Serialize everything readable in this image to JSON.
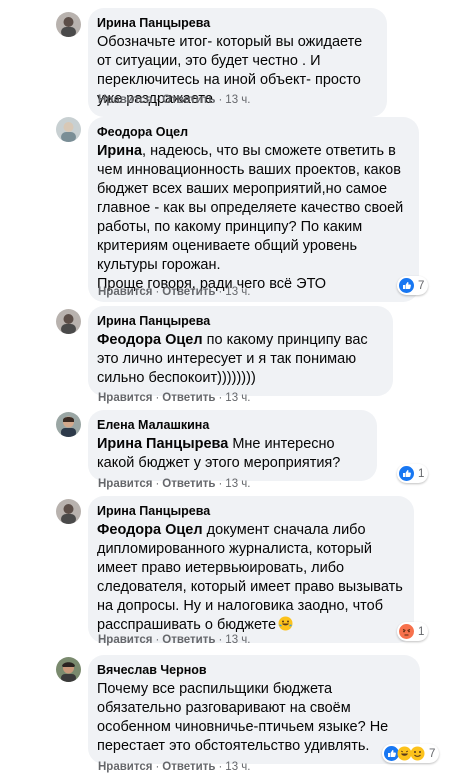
{
  "labels": {
    "like": "Нравится",
    "reply": "Ответить",
    "dot": "·"
  },
  "colors": {
    "bubble": "#f0f2f5",
    "meta": "#65676b",
    "like_blue": "#1877f2",
    "angry_orange": "#f7714c"
  },
  "comments": [
    {
      "author": "Ирина Панцырева",
      "mention": "",
      "text": "Обозначьте итог- который вы ожидаете от ситуации, это будет честно . И переключитесь на иной объект- просто уже раздражаете",
      "time": "13 ч.",
      "reactions": null
    },
    {
      "author": "Феодора Оцел",
      "mention": "Ирина",
      "text": ", надеюсь, что вы сможете ответить в чем инновационность ваших проектов, каков бюджет всех ваших мероприятий,но самое главное - как вы определяете качество своей работы, по какому принципу? По каким критериям оцениваете общий уровень культуры горожан.",
      "text2": "Проще говоря, ради чего всё ЭТО",
      "time": "13 ч.",
      "reactions": {
        "icons": [
          "like-icon",
          "love-icon"
        ],
        "count": "7"
      }
    },
    {
      "author": "Ирина Панцырева",
      "mention": "Феодора Оцел",
      "text": " по какому принципу вас это лично интересует и я так понимаю сильно беспокоит))))))))",
      "time": "13 ч.",
      "reactions": null
    },
    {
      "author": "Елена Малашкина",
      "mention": "Ирина Панцырева",
      "text": " Мне интересно какой бюджет у этого мероприятия?",
      "time": "13 ч.",
      "reactions": {
        "icons": [
          "like-icon"
        ],
        "count": "1"
      }
    },
    {
      "author": "Ирина Панцырева",
      "mention": "Феодора Оцел",
      "text": " документ сначала либо дипломированного журналиста, который имеет право иетервьюировать, либо следователя, который имеет право вызывать на допросы. Ну и налоговика заодно, чтоб расспрашивать о бюджете",
      "emoji": "rofl-emoji",
      "time": "13 ч.",
      "reactions": {
        "icons": [
          "angry-icon"
        ],
        "count": "1"
      }
    },
    {
      "author": "Вячеслав Чернов",
      "mention": "",
      "text": "Почему все распильщики бюджета обязательно разговаривают на своём особенном чиновничье-птичьем языке? Не перестает это обстоятельство удивлять.",
      "time": "13 ч.",
      "reactions": {
        "icons": [
          "like-icon",
          "haha-icon",
          "laugh-icon"
        ],
        "count": "7"
      }
    }
  ]
}
